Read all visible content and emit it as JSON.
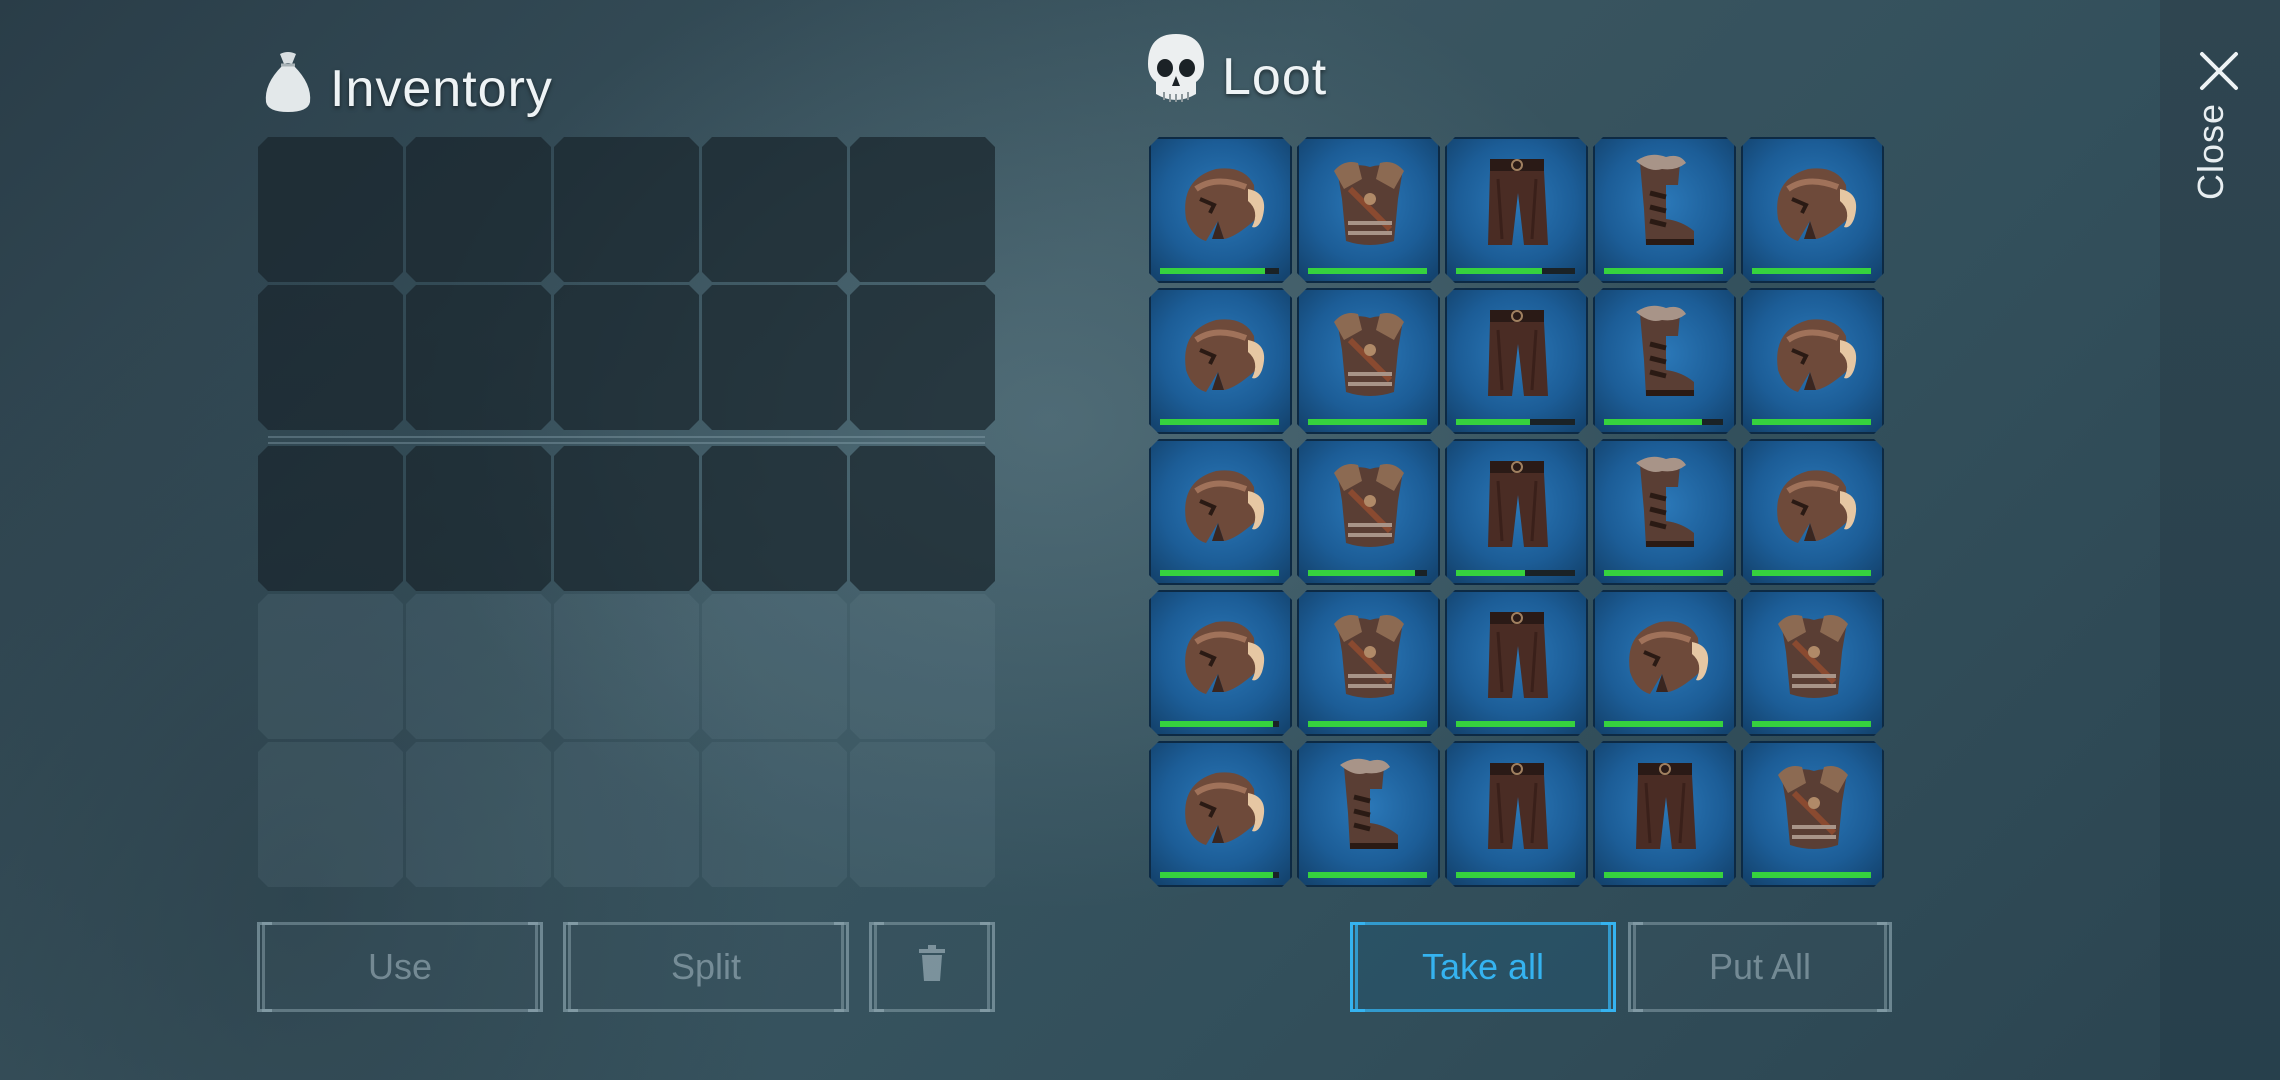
{
  "inventory": {
    "title": "Inventory",
    "icon": "bag-icon",
    "unlocked_rows": 3,
    "locked_rows": 2,
    "columns": 5
  },
  "loot": {
    "title": "Loot",
    "icon": "skull-icon",
    "items": [
      {
        "type": "helmet",
        "durability": 0.88
      },
      {
        "type": "chest",
        "durability": 1.0
      },
      {
        "type": "pants",
        "durability": 0.72
      },
      {
        "type": "boots",
        "durability": 1.0
      },
      {
        "type": "helmet",
        "durability": 1.0
      },
      {
        "type": "helmet",
        "durability": 1.0
      },
      {
        "type": "chest",
        "durability": 1.0
      },
      {
        "type": "pants",
        "durability": 0.62
      },
      {
        "type": "boots",
        "durability": 0.82
      },
      {
        "type": "helmet",
        "durability": 1.0
      },
      {
        "type": "helmet",
        "durability": 1.0
      },
      {
        "type": "chest",
        "durability": 0.9
      },
      {
        "type": "pants",
        "durability": 0.58
      },
      {
        "type": "boots",
        "durability": 1.0
      },
      {
        "type": "helmet",
        "durability": 1.0
      },
      {
        "type": "helmet",
        "durability": 0.95
      },
      {
        "type": "chest",
        "durability": 1.0
      },
      {
        "type": "pants",
        "durability": 1.0
      },
      {
        "type": "helmet",
        "durability": 1.0
      },
      {
        "type": "chest",
        "durability": 1.0
      },
      {
        "type": "helmet",
        "durability": 0.95
      },
      {
        "type": "boots",
        "durability": 1.0
      },
      {
        "type": "pants",
        "durability": 1.0
      },
      {
        "type": "pants",
        "durability": 1.0
      },
      {
        "type": "chest",
        "durability": 1.0
      }
    ]
  },
  "buttons": {
    "use": "Use",
    "split": "Split",
    "delete_icon": "trash-icon",
    "take_all": "Take all",
    "put_all": "Put All"
  },
  "close": {
    "label": "Close",
    "icon": "close-icon"
  },
  "colors": {
    "accent": "#35b3f0",
    "durability": "#36d23e",
    "slot_blue": "#1c5d97"
  }
}
